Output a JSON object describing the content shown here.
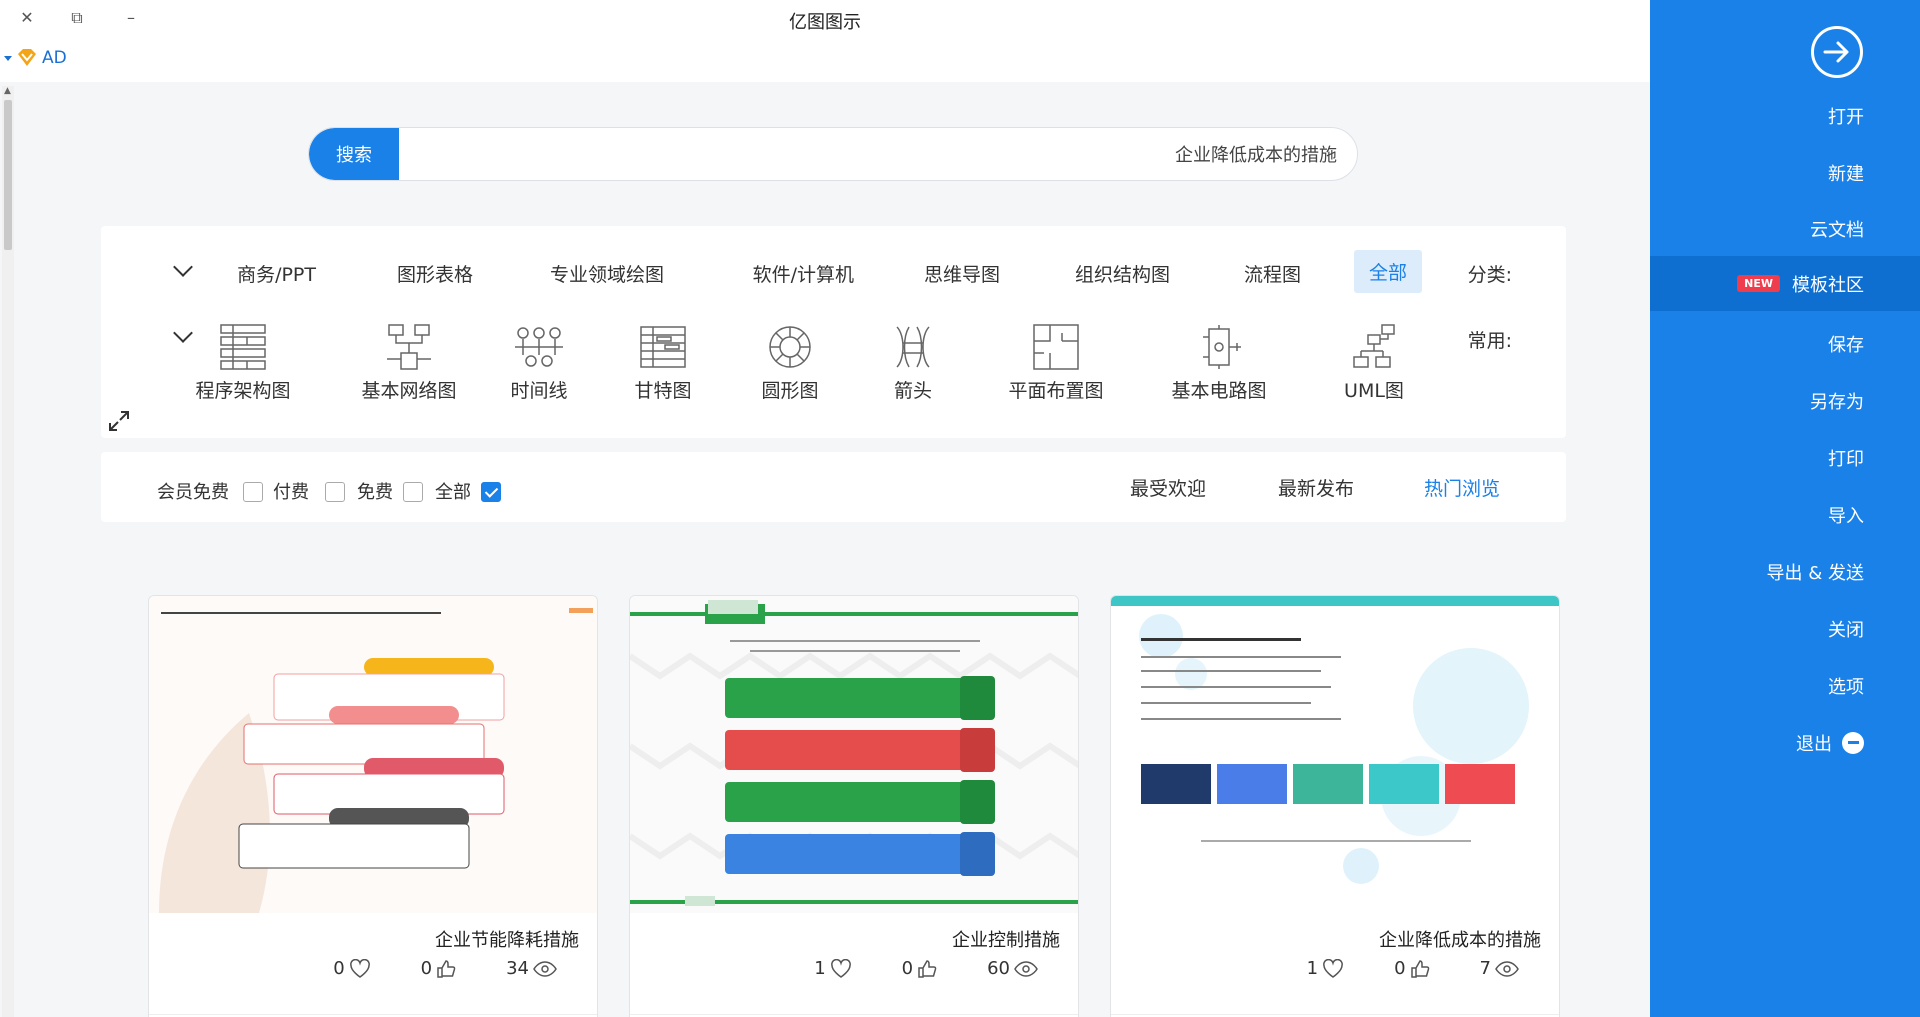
{
  "window": {
    "title": "亿图图示",
    "close": "✕",
    "restore": "⧉",
    "minimize": "–"
  },
  "ad": {
    "label": "AD"
  },
  "sidebar": {
    "items": [
      {
        "label": "打开"
      },
      {
        "label": "新建"
      },
      {
        "label": "云文档"
      },
      {
        "label": "模板社区",
        "badge": "NEW"
      },
      {
        "label": "保存"
      },
      {
        "label": "另存为"
      },
      {
        "label": "打印"
      },
      {
        "label": "导入"
      },
      {
        "label": "导出 & 发送"
      },
      {
        "label": "关闭"
      },
      {
        "label": "选项"
      },
      {
        "label": "退出"
      }
    ]
  },
  "search": {
    "button": "搜索",
    "value": "企业降低成本的措施"
  },
  "categories": {
    "label": "分类:",
    "items": [
      "全部",
      "流程图",
      "组织结构图",
      "思维导图",
      "软件/计算机",
      "专业领域绘图",
      "图形表格",
      "商务/PPT"
    ]
  },
  "common": {
    "label": "常用:",
    "items": [
      "UML图",
      "基本电路图",
      "平面布置图",
      "箭头",
      "圆形图",
      "甘特图",
      "时间线",
      "基本网络图",
      "程序架构图"
    ]
  },
  "sort": {
    "tabs": [
      "热门浏览",
      "最新发布",
      "最受欢迎"
    ]
  },
  "filters": [
    {
      "label": "全部",
      "checked": true
    },
    {
      "label": "免费",
      "checked": false
    },
    {
      "label": "付费",
      "checked": false
    },
    {
      "label": "会员免费",
      "checked": false
    }
  ],
  "cards": [
    {
      "title": "企业降低成本的措施",
      "views": "7",
      "likes": "0",
      "favs": "1",
      "thumb_title": "企业降低成本的措施"
    },
    {
      "title": "企业控制措施",
      "views": "60",
      "likes": "0",
      "favs": "1",
      "thumb_title": ""
    },
    {
      "title": "企业节能降耗措施",
      "views": "34",
      "likes": "0",
      "favs": "0",
      "thumb_title": "企业节能降耗措施"
    }
  ]
}
